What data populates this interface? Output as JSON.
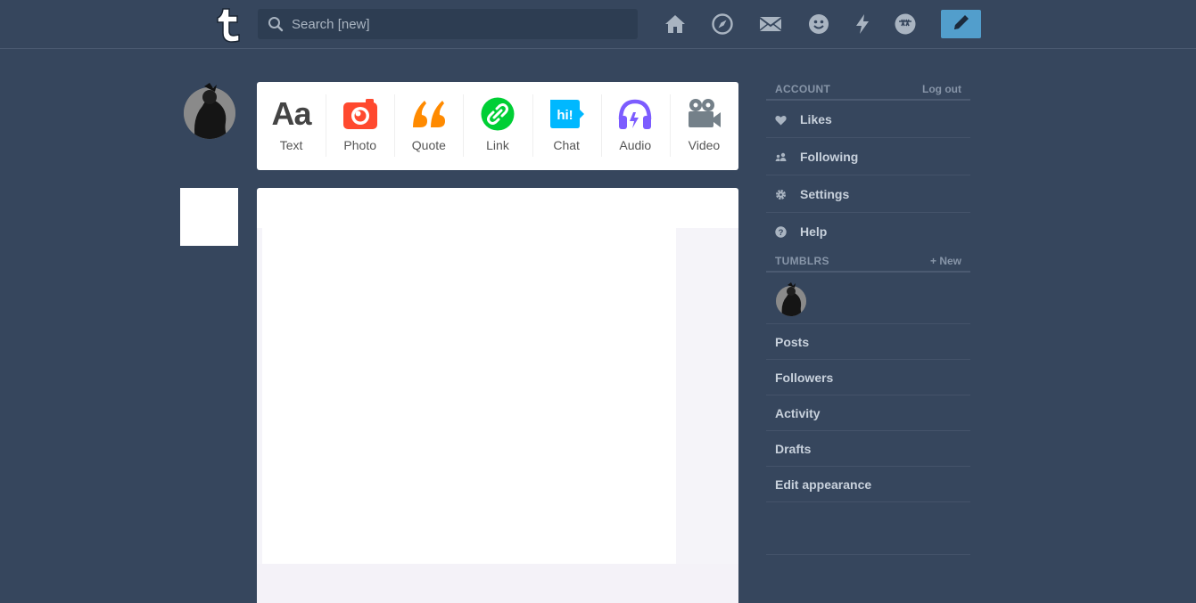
{
  "header": {
    "logo_icon": "tumblr-t-logo",
    "search_placeholder": "Search [new]",
    "nav_icons": [
      "home-icon",
      "explore-compass-icon",
      "inbox-mail-icon",
      "messaging-smiley-icon",
      "activity-lightning-icon",
      "sunglasses-icon"
    ],
    "compose_icon": "pencil-icon",
    "accent_color": "#529ecc"
  },
  "post_types": [
    {
      "label": "Text",
      "icon": "text-aa-icon",
      "color": "#444444"
    },
    {
      "label": "Photo",
      "icon": "camera-icon",
      "color": "#ff492f"
    },
    {
      "label": "Quote",
      "icon": "quote-icon",
      "color": "#ff8a00"
    },
    {
      "label": "Link",
      "icon": "link-icon",
      "color": "#00cf35"
    },
    {
      "label": "Chat",
      "icon": "chat-hi-icon",
      "color": "#00b8ff"
    },
    {
      "label": "Audio",
      "icon": "headphones-icon",
      "color": "#7c5cff"
    },
    {
      "label": "Video",
      "icon": "video-camera-icon",
      "color": "#748089"
    }
  ],
  "sidebar": {
    "account": {
      "title": "ACCOUNT",
      "action": "Log out",
      "items": [
        {
          "label": "Likes",
          "icon": "heart-icon"
        },
        {
          "label": "Following",
          "icon": "people-icon"
        },
        {
          "label": "Settings",
          "icon": "gear-icon"
        },
        {
          "label": "Help",
          "icon": "question-icon"
        }
      ]
    },
    "tumblrs": {
      "title": "TUMBLRS",
      "action": "+ New",
      "items": [
        {
          "label": "Posts"
        },
        {
          "label": "Followers"
        },
        {
          "label": "Activity"
        },
        {
          "label": "Drafts"
        },
        {
          "label": "Edit appearance"
        }
      ]
    }
  }
}
